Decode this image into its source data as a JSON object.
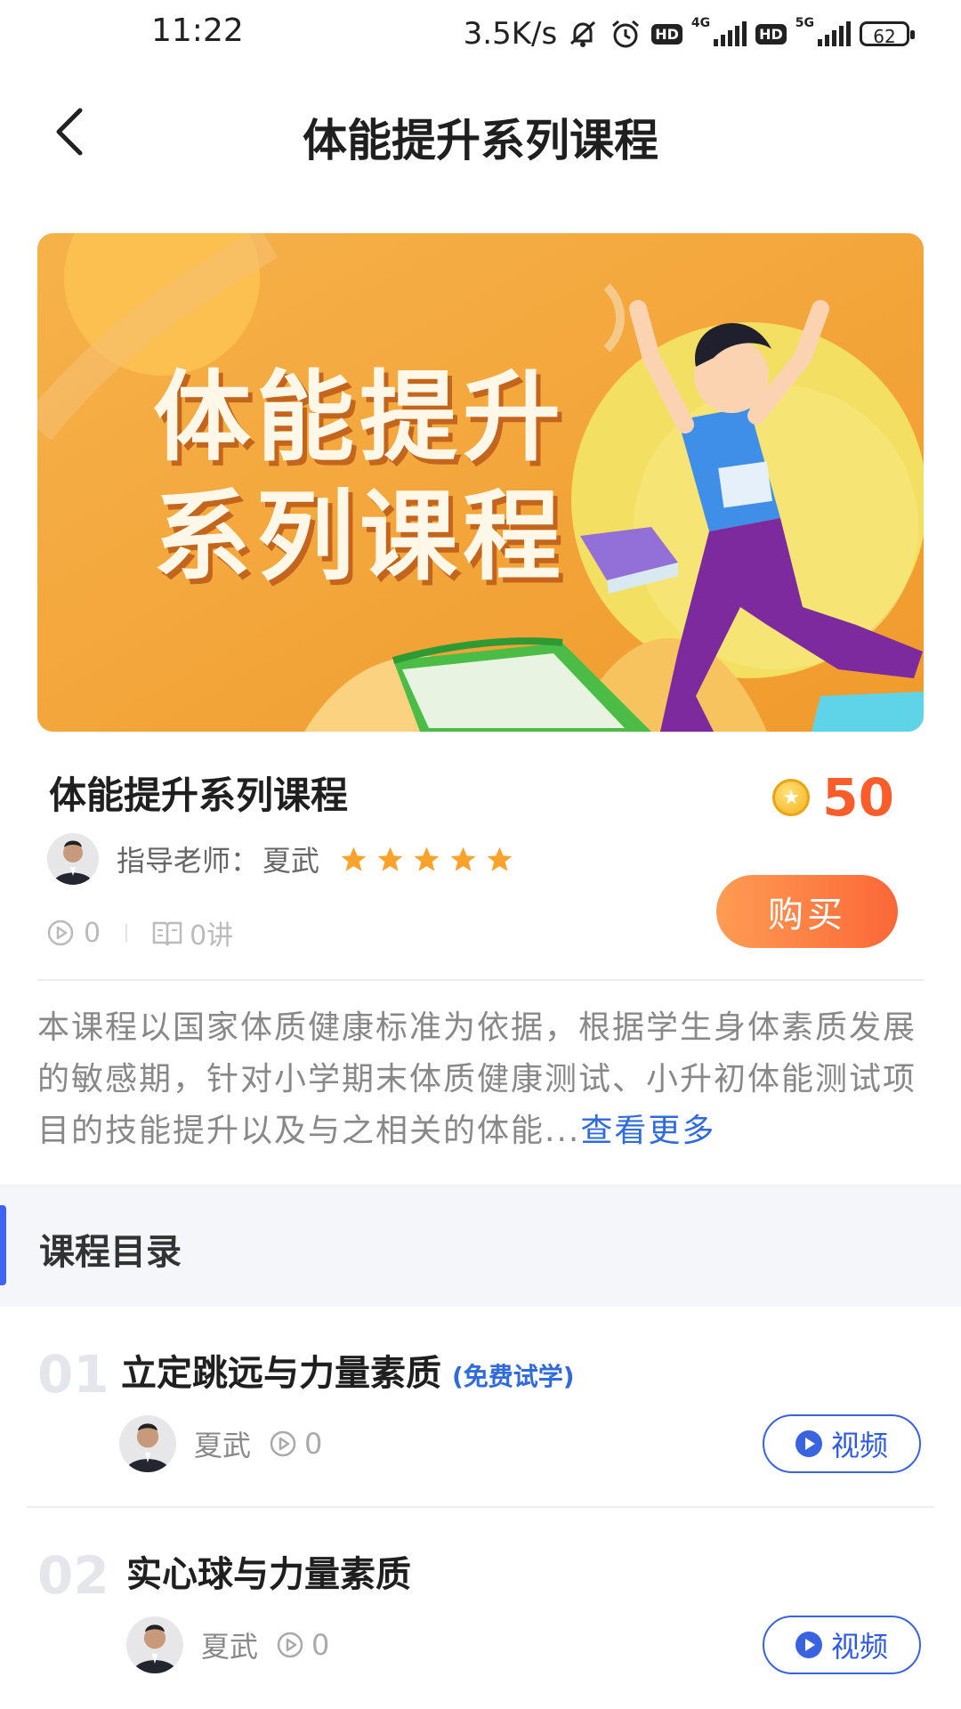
{
  "status_bar": {
    "time": "11:22",
    "net_speed": "3.5K/s",
    "hd1": "HD",
    "net1": "4G",
    "hd2": "HD",
    "net2": "5G",
    "battery": "62"
  },
  "header": {
    "title": "体能提升系列课程",
    "back_icon": "chevron-left-icon"
  },
  "banner": {
    "line1": "体能提升",
    "line2": "系列课程"
  },
  "course": {
    "title": "体能提升系列课程",
    "price": "50",
    "teacher_label": "指导老师：",
    "teacher_name": "夏武",
    "rating": 5,
    "play_count": "0",
    "lecture_count": "0讲",
    "buy_label": "购买",
    "description": "本课程以国家体质健康标准为依据，根据学生身体素质发展的敏感期，针对小学期末体质健康测试、小升初体能测试项目的技能提升以及与之相关的体能...",
    "more_label": "查看更多",
    "colors": {
      "price": "#fa5c2a",
      "accent": "#3f63f3",
      "link": "#2f6bde"
    }
  },
  "catalog": {
    "title": "课程目录",
    "lessons": [
      {
        "num": "01",
        "title": "立定跳远与力量素质",
        "tag": "(免费试学)",
        "teacher": "夏武",
        "views": "0",
        "button": "视频"
      },
      {
        "num": "02",
        "title": "实心球与力量素质",
        "tag": "",
        "teacher": "夏武",
        "views": "0",
        "button": "视频"
      }
    ]
  }
}
